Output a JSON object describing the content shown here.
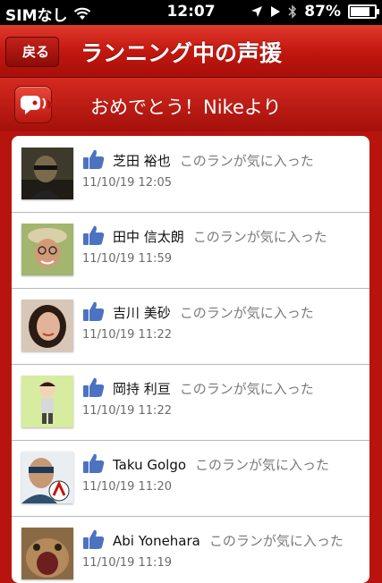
{
  "status": {
    "carrier": "SIMなし",
    "time": "12:07",
    "battery": "87%",
    "battery_level": 0.87
  },
  "nav": {
    "back_label": "戻る",
    "title": "ランニング中の声援"
  },
  "banner": {
    "message": "おめでとう！Nikeより"
  },
  "entries": [
    {
      "name": "芝田 裕也",
      "action": "このランが気に入った",
      "date": "11/10/19 12:05"
    },
    {
      "name": "田中 信太朗",
      "action": "このランが気に入った",
      "date": "11/10/19 11:59"
    },
    {
      "name": "吉川 美砂",
      "action": "このランが気に入った",
      "date": "11/10/19 11:22"
    },
    {
      "name": "岡持 利亘",
      "action": "このランが気に入った",
      "date": "11/10/19 11:22"
    },
    {
      "name": "Taku Golgo",
      "action": "このランが気に入った",
      "date": "11/10/19 11:20"
    },
    {
      "name": "Abi Yonehara",
      "action": "このランが気に入った",
      "date": "11/10/19 11:19"
    }
  ],
  "icons": {
    "like": "thumbs-up-icon",
    "cheer": "cheer-bubble-icon"
  },
  "colors": {
    "accent": "#c4170f",
    "like_blue": "#4c73c2"
  }
}
